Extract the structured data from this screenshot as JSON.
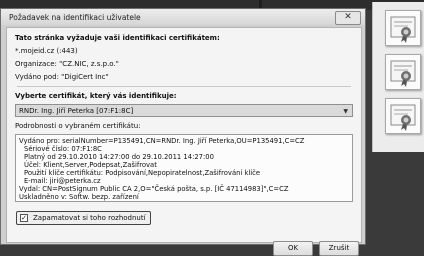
{
  "dialog": {
    "title": "Požadavek na identifikaci uživatele",
    "close_glyph": "✕",
    "site_section": {
      "heading": "Tato stránka vyžaduje vaši identifikaci certifikátem:",
      "host": "*.mojeid.cz (:443)",
      "organization": "Organizace: \"CZ.NIC, z.s.p.o.\"",
      "issuer": "Vydáno pod: \"DigiCert Inc\""
    },
    "choose_label": "Vyberte certifikát, který vás identifikuje:",
    "selected_certificate": "RNDr. Ing. Jiří Peterka [07:F1:8C]",
    "details_label": "Podrobnosti o vybraném certifikátu:",
    "details_lines": [
      "Vydáno pro: serialNumber=P135491,CN=RNDr. Ing. Jiří Peterka,OU=P135491,C=CZ",
      "Sériové číslo: 07:F1:8C",
      "Platný od 29.10.2010 14:27:00 do 29.10.2011 14:27:00",
      "Účel: Klient,Server,Podepsat,Zašifrovat",
      "Použití klíče certifikátu: Podpisování,Nepopiratelnost,Zašifrování klíče",
      "E-mail: jiri@peterka.cz",
      "Vydal: CN=PostSignum Public CA 2,O=\"Česká pošta, s.p. [IČ 47114983]\",C=CZ",
      "Uskladněno v: Softw. bezp. zařízení"
    ],
    "remember_label": "Zapamatovat si toho rozhodnutí",
    "remember_check": "✓",
    "ok_label": "OK",
    "cancel_label": "Zrušit"
  },
  "icons": {
    "dropdown": "▼"
  }
}
